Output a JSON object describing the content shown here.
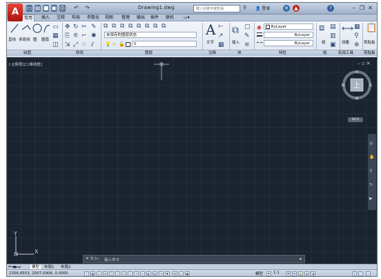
{
  "title_bar": {
    "app_logo": "A",
    "document_title": "Drawing1.dwg",
    "search_placeholder": "键入关键字或短语",
    "signin_label": "登录",
    "quick_access_icons": [
      "new-icon",
      "open-icon",
      "save-icon",
      "saveas-icon",
      "print-icon",
      "undo-icon",
      "redo-icon"
    ]
  },
  "ribbon_tabs": [
    "常用",
    "插入",
    "注释",
    "布局",
    "参数化",
    "视图",
    "管理",
    "输出",
    "插件",
    "联机"
  ],
  "active_tab": "常用",
  "ribbon": {
    "draw": {
      "line": "直线",
      "polyline": "多段线",
      "circle": "圆",
      "arc": "圆弧"
    },
    "layer_state": "未保存的图层状态",
    "layer_current": "0",
    "text_label": "文字",
    "insert_label": "插入",
    "properties": {
      "color": "ByLayer",
      "linetype": "ByLayer",
      "lineweight": "ByLayer"
    },
    "group_label": "组",
    "measure_label": "测量",
    "paste_label": "剪贴板"
  },
  "panels": [
    "绘图",
    "修改",
    "图层",
    "注释",
    "块",
    "特性",
    "组",
    "实用工具",
    "剪贴板"
  ],
  "viewport": {
    "label": "[-][俯视][二维线框]",
    "viewcube": {
      "top_face": "上",
      "north": "北",
      "south": "南",
      "east": "东",
      "west": "西"
    },
    "wcs_label": "WCS",
    "ucs_x": "X",
    "ucs_y": "Y"
  },
  "command_line": {
    "placeholder": "键入命令"
  },
  "layout_tabs": [
    "模型",
    "布局1",
    "布局2"
  ],
  "status_bar": {
    "coordinates": "2356.8553, 2007.0906, 0.0000",
    "model_label": "模型",
    "scale_label": "1:1"
  },
  "colors": {
    "accent": "#c0241a",
    "viewport_bg": "#1b2330",
    "ribbon_bg": "#e8eef6"
  }
}
